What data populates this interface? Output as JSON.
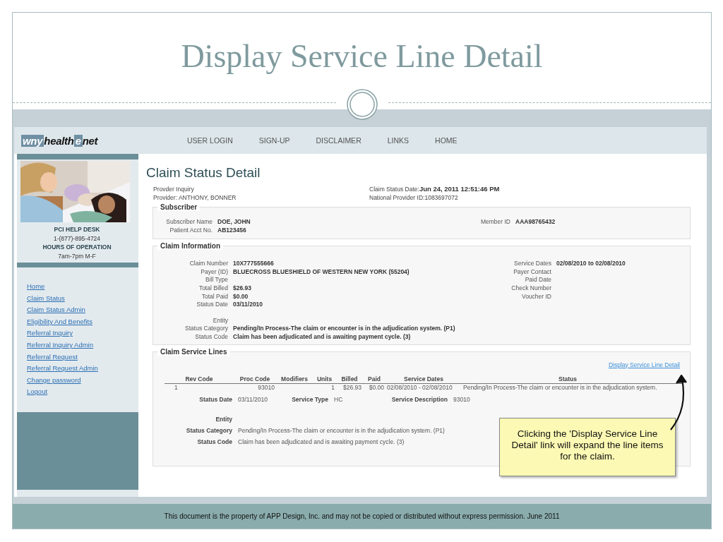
{
  "slide": {
    "title": "Display Service Line Detail",
    "footer": "This document is the property of APP Design, Inc. and may not be copied or distributed without express permission.  June 2011"
  },
  "site": {
    "logo": [
      {
        "text": "wny",
        "kind": "boxed"
      },
      {
        "text": "health",
        "kind": "plain"
      },
      {
        "text": "e",
        "kind": "boxed"
      },
      {
        "text": "net",
        "kind": "plain"
      }
    ],
    "nav": [
      "USER LOGIN",
      "SIGN-UP",
      "DISCLAIMER",
      "LINKS",
      "HOME"
    ]
  },
  "sidebar": {
    "help": [
      {
        "text": "PCI HELP DESK",
        "bold": true
      },
      {
        "text": "1-(877)-895-4724",
        "bold": false
      },
      {
        "text": "HOURS OF OPERATION",
        "bold": true
      },
      {
        "text": "7am-7pm M-F",
        "bold": false
      }
    ],
    "links": [
      "Home",
      "Claim Status",
      "Claim Status Admin",
      "Eligibility And Benefits",
      "Referral Inquiry",
      "Referral Inquiry Admin",
      "Referral Request",
      "Referral Request Admin",
      "Change password",
      "Logout"
    ]
  },
  "page": {
    "title": "Claim Status Detail",
    "info_left": [
      "Provder Inquiry",
      "Provider: ANTHONY, BONNER"
    ],
    "info_right": [
      {
        "label": "Claim Status Date:",
        "value": "Jun 24, 2011 12:51:46 PM",
        "bold": true
      },
      {
        "label": "National Provider ID:",
        "value": "1083697072",
        "bold": false
      }
    ]
  },
  "subscriber": {
    "legend": "Subscriber",
    "left": [
      {
        "label": "Subscriber Name",
        "value": "DOE, JOHN"
      },
      {
        "label": "Patient Acct No.",
        "value": "AB123456"
      }
    ],
    "right": [
      {
        "label": "Member ID",
        "value": "AAA98765432"
      }
    ]
  },
  "claim_information": {
    "legend": "Claim Information",
    "left": [
      {
        "label": "Claim Number",
        "value": "10X777555666"
      },
      {
        "label": "Payer (ID)",
        "value": "BLUECROSS BLUESHIELD OF WESTERN NEW YORK (55204)"
      },
      {
        "label": "Bill Type"
      },
      {
        "label": "Total Billed",
        "value": "$26.93"
      },
      {
        "label": "Total Paid",
        "value": "$0.00"
      },
      {
        "label": "Status Date",
        "value": "03/11/2010"
      }
    ],
    "status": [
      {
        "label": "Entity"
      },
      {
        "label": "Status Category",
        "value": "Pending/In Process-The claim or encounter is in the adjudication system. (P1)"
      },
      {
        "label": "Status Code",
        "value": "Claim has been adjudicated and is awaiting payment cycle. (3)"
      }
    ],
    "right": [
      {
        "label": "Service Dates",
        "value": "02/08/2010 to 02/08/2010"
      },
      {
        "label": "Payer Contact"
      },
      {
        "label": "Paid Date"
      },
      {
        "label": "Check Number"
      },
      {
        "label": "Voucher ID"
      }
    ]
  },
  "service_lines": {
    "legend": "Claim Service Lines",
    "link": "Display Service Line Detail",
    "columns": [
      "Rev Code",
      "Proc Code",
      "Modifiers",
      "Units",
      "Billed",
      "Paid",
      "Service Dates",
      "Status"
    ],
    "rows": [
      {
        "cells": [
          "1",
          "93010",
          "",
          "1",
          "$26.93",
          "$0.00",
          "02/08/2010 - 02/08/2010",
          "Pending/In Process-The claim or encounter is in the adjudication system."
        ]
      }
    ],
    "detail_top": [
      {
        "label": "Status Date",
        "value": "03/11/2010"
      },
      {
        "label": "Service Type",
        "value": "HC"
      },
      {
        "label": "Service Description",
        "value": "93010"
      }
    ],
    "detail_status": [
      {
        "label": "Entity"
      },
      {
        "label": "Status Category",
        "value": "Pending/In Process-The claim or encounter is in the adjudication system. (P1)"
      },
      {
        "label": "Status Code",
        "value": "Claim has been adjudicated and is awaiting payment cycle. (3)"
      }
    ],
    "callout": "Clicking the 'Display Service Line Detail' link will expand the line items for the claim."
  }
}
